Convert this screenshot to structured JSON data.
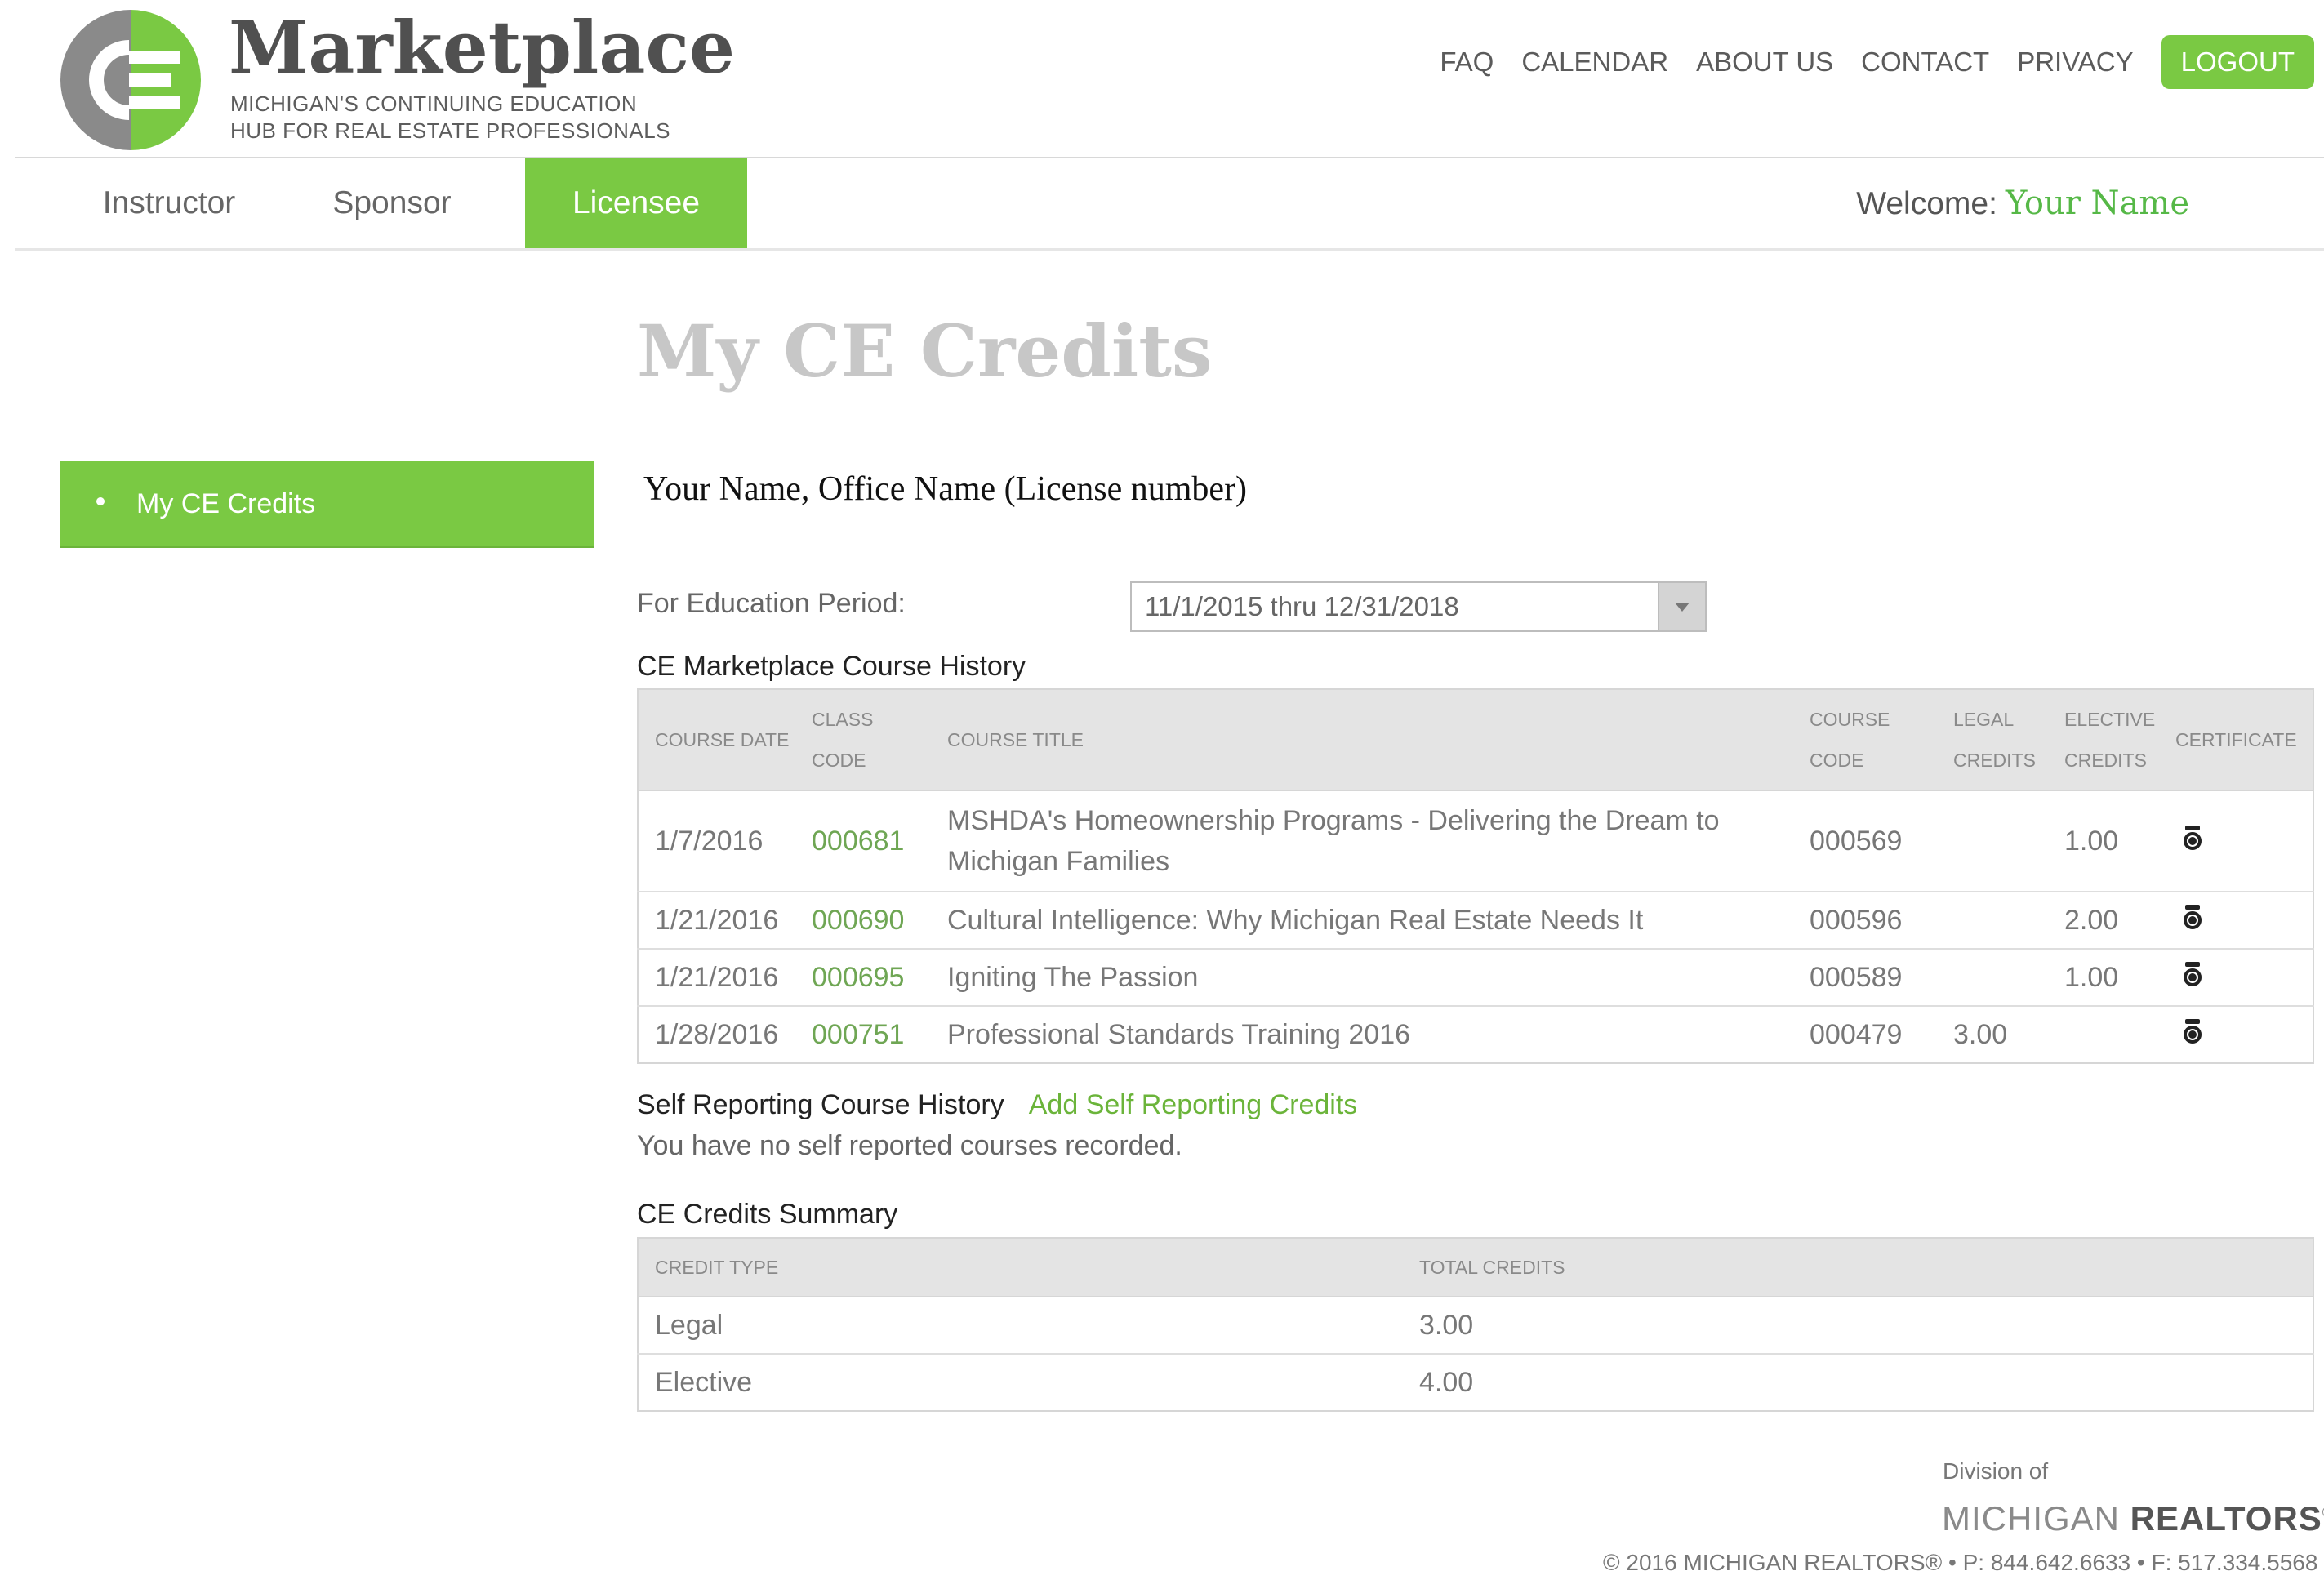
{
  "header": {
    "logo_text": "CE",
    "brand_title": "Marketplace",
    "brand_sub_line1": "MICHIGAN'S CONTINUING EDUCATION",
    "brand_sub_line2": "HUB FOR REAL ESTATE PROFESSIONALS",
    "nav": [
      "FAQ",
      "CALENDAR",
      "ABOUT US",
      "CONTACT",
      "PRIVACY"
    ],
    "logout_label": "LOGOUT"
  },
  "subnav": {
    "tabs": [
      "Instructor",
      "Sponsor",
      "Licensee"
    ],
    "active_tab": "Licensee",
    "welcome_label": "Welcome:",
    "user_name": "Your Name"
  },
  "sidebar": {
    "items": [
      {
        "label": "My CE Credits",
        "active": true
      }
    ]
  },
  "main": {
    "title": "My CE Credits",
    "identity": "Your Name, Office Name (License number)",
    "period_label": "For Education Period:",
    "period_value": "11/1/2015 thru 12/31/2018",
    "history_title": "CE Marketplace Course History",
    "history_headers": {
      "course_date": "COURSE DATE",
      "class_code_1": "CLASS",
      "class_code_2": "CODE",
      "course_title": "COURSE TITLE",
      "course_code_1": "COURSE",
      "course_code_2": "CODE",
      "legal_1": "LEGAL",
      "legal_2": "CREDITS",
      "elective_1": "ELECTIVE",
      "elective_2": "CREDITS",
      "certificate": "CERTIFICATE"
    },
    "history_rows": [
      {
        "date": "1/7/2016",
        "class_code": "000681",
        "title": "MSHDA's Homeownership Programs - Delivering the Dream to Michigan Families",
        "course_code": "000569",
        "legal": "",
        "elective": "1.00"
      },
      {
        "date": "1/21/2016",
        "class_code": "000690",
        "title": "Cultural Intelligence: Why Michigan Real Estate Needs It",
        "course_code": "000596",
        "legal": "",
        "elective": "2.00"
      },
      {
        "date": "1/21/2016",
        "class_code": "000695",
        "title": "Igniting The Passion",
        "course_code": "000589",
        "legal": "",
        "elective": "1.00"
      },
      {
        "date": "1/28/2016",
        "class_code": "000751",
        "title": "Professional Standards Training 2016",
        "course_code": "000479",
        "legal": "3.00",
        "elective": ""
      }
    ],
    "self_title": "Self Reporting Course History",
    "self_add_link": "Add Self Reporting Credits",
    "self_empty": "You have no self reported courses recorded.",
    "summary_title": "CE Credits Summary",
    "summary_headers": {
      "type": "CREDIT TYPE",
      "total": "TOTAL CREDITS"
    },
    "summary_rows": [
      {
        "type": "Legal",
        "total": "3.00"
      },
      {
        "type": "Elective",
        "total": "4.00"
      }
    ]
  },
  "footer": {
    "division": "Division of",
    "brand_light": "MICHIGAN",
    "brand_bold": "REALTORS",
    "brand_mark": "®",
    "copyright": "© 2016 MICHIGAN REALTORS® • P: 844.642.6633 • F: 517.334.5568"
  },
  "colors": {
    "accent": "#7ac943",
    "title_gray": "#c7c7c7",
    "link_green": "#6fa654"
  }
}
